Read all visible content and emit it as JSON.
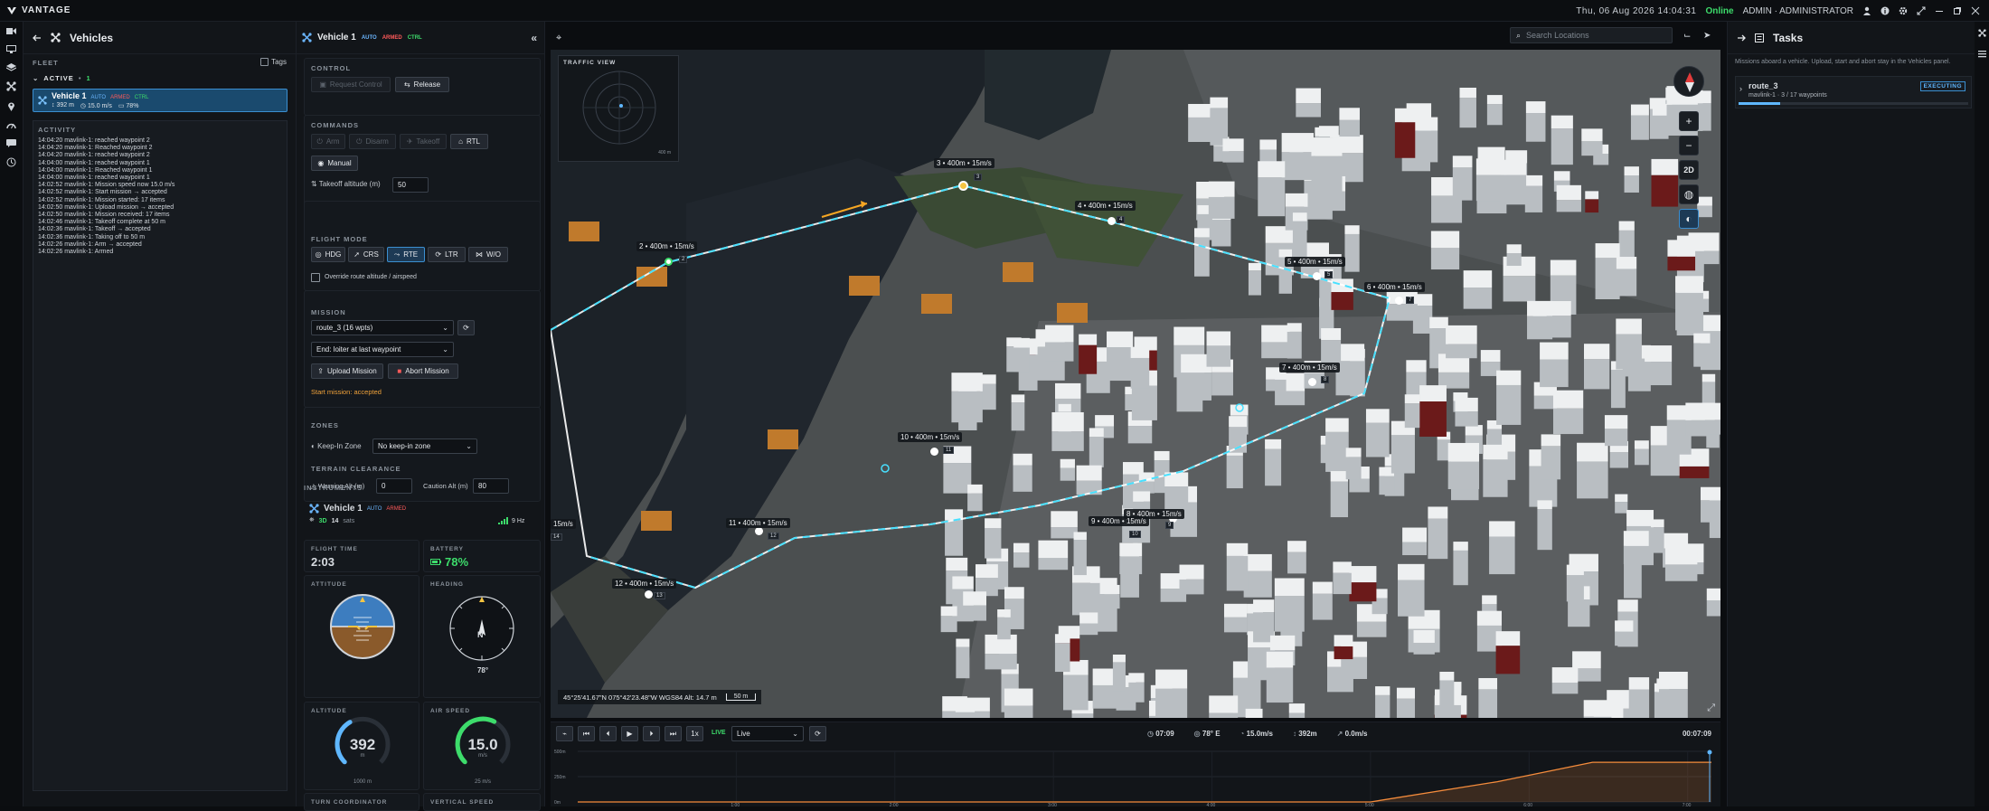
{
  "app": {
    "brand": "VANTAGE",
    "datetime": "Thu, 06 Aug 2026 14:04:31",
    "status": "Online",
    "user": "ADMIN · ADMINISTRATOR"
  },
  "vehicles_panel": {
    "title": "Vehicles",
    "fleet_label": "FLEET",
    "tags_label": "Tags",
    "active_label": "ACTIVE",
    "active_count": "1",
    "vehicle": {
      "name": "Vehicle 1",
      "mode": "AUTO",
      "armed": "ARMED",
      "ctrl": "CTRL",
      "alt": "392 m",
      "speed": "15.0 m/s",
      "battery": "78%"
    },
    "activity_label": "ACTIVITY",
    "log": [
      "14:04:20  mavlink-1: reached waypoint 2",
      "14:04:20  mavlink-1: Reached waypoint 2",
      "14:04:20  mavlink-1: reached waypoint 2",
      "14:04:00  mavlink-1: reached waypoint 1",
      "14:04:00  mavlink-1: Reached waypoint 1",
      "14:04:00  mavlink-1: reached waypoint 1",
      "14:02:52  mavlink-1: Mission speed now 15.0 m/s",
      "14:02:52  mavlink-1: Start mission → accepted",
      "14:02:52  mavlink-1: Mission started: 17 items",
      "14:02:50  mavlink-1: Upload mission → accepted",
      "14:02:50  mavlink-1: Mission received: 17 items",
      "14:02:46  mavlink-1: Takeoff complete at 50 m",
      "14:02:36  mavlink-1: Takeoff → accepted",
      "14:02:36  mavlink-1: Taking off to 50 m",
      "14:02:26  mavlink-1: Arm → accepted",
      "14:02:26  mavlink-1: Armed"
    ]
  },
  "control_panel": {
    "vehicle": "Vehicle 1",
    "mode": "AUTO",
    "armed": "ARMED",
    "ctrl": "CTRL",
    "control_label": "CONTROL",
    "request_control": "Request Control",
    "release": "Release",
    "commands_label": "COMMANDS",
    "arm": "Arm",
    "disarm": "Disarm",
    "takeoff": "Takeoff",
    "rtl": "RTL",
    "manual": "Manual",
    "takeoff_alt_label": "Takeoff altitude (m)",
    "takeoff_alt": "50",
    "flight_mode_label": "FLIGHT MODE",
    "modes": [
      "HDG",
      "CRS",
      "RTE",
      "LTR",
      "W/O"
    ],
    "override_label": "Override route altitude / airspeed",
    "mission_label": "MISSION",
    "route_select": "route_3 (16 wpts)",
    "end_select": "End: loiter at last waypoint",
    "upload": "Upload Mission",
    "abort": "Abort Mission",
    "start_status": "Start mission: accepted",
    "zones_label": "ZONES",
    "keepin_label": "Keep-In Zone",
    "keepin_value": "No keep-in zone",
    "terrain_label": "TERRAIN CLEARANCE",
    "warning_label": "Warning Alt (m)",
    "warning_value": "0",
    "caution_label": "Caution Alt (m)",
    "caution_value": "80",
    "instruments_label": "INSTRUMENTS",
    "inst_vehicle": "Vehicle 1",
    "inst_mode": "AUTO",
    "inst_armed": "ARMED",
    "fix": "3D",
    "sats": "14",
    "sats_label": "sats",
    "rate": "9 Hz",
    "flight_time_label": "FLIGHT TIME",
    "flight_time": "2:03",
    "battery_label": "BATTERY",
    "battery": "78%",
    "attitude_label": "ATTITUDE",
    "heading_label": "HEADING",
    "heading_value": "78°",
    "altitude_label": "ALTITUDE",
    "altitude_value": "392",
    "altitude_unit": "m",
    "altitude_max": "1000 m",
    "altitude_fraction": 0.39,
    "airspeed_label": "AIR SPEED",
    "airspeed_value": "15.0",
    "airspeed_unit": "m/s",
    "airspeed_max": "25 m/s",
    "airspeed_fraction": 0.6,
    "turn_label": "TURN COORDINATOR",
    "vs_label": "VERTICAL SPEED"
  },
  "map": {
    "search_placeholder": "Search Locations",
    "traffic_label": "TRAFFIC VIEW",
    "radar_range": "400 m",
    "coords": "45°25'41.67\"N 075°42'23.48\"W WGS84 Alt: 14.7 m",
    "scale": "50 m",
    "btn_2d": "2D",
    "waypoints": [
      {
        "label": "2 • 400m • 15m/s",
        "idx": "2"
      },
      {
        "label": "3 • 400m • 15m/s",
        "idx": "3"
      },
      {
        "label": "4 • 400m • 15m/s",
        "idx": "4"
      },
      {
        "label": "5 • 400m • 15m/s",
        "idx": "5"
      },
      {
        "label": "6 • 400m • 15m/s",
        "idx": "7"
      },
      {
        "label": "7 • 400m • 15m/s",
        "idx": "8"
      },
      {
        "label": "8 • 400m • 15m/s",
        "idx": "9"
      },
      {
        "label": "9 • 400m • 15m/s",
        "idx": "10"
      },
      {
        "label": "10 • 400m • 15m/s",
        "idx": "11"
      },
      {
        "label": "11 • 400m • 15m/s",
        "idx": "12"
      },
      {
        "label": "12 • 400m • 15m/s",
        "idx": "13"
      },
      {
        "label": "15m/s",
        "idx": "14"
      }
    ]
  },
  "timeline": {
    "speed": "1x",
    "live": "LIVE",
    "live_select": "Live",
    "time": "07:09",
    "heading": "78° E",
    "speed_val": "15.0m/s",
    "alt": "392m",
    "vs": "0.0m/s",
    "total": "00:07:09",
    "y_ticks": [
      "500m",
      "250m",
      "0m"
    ],
    "x_ticks": [
      "1:00",
      "2:00",
      "3:00",
      "4:00",
      "5:00",
      "6:00",
      "7:00"
    ]
  },
  "tasks": {
    "title": "Tasks",
    "hint": "Missions aboard a vehicle. Upload, start and abort stay in the Vehicles panel.",
    "route": "route_3",
    "status": "EXECUTING",
    "detail": "mavlink-1 · 3 / 17 waypoints",
    "progress": 0.18
  }
}
